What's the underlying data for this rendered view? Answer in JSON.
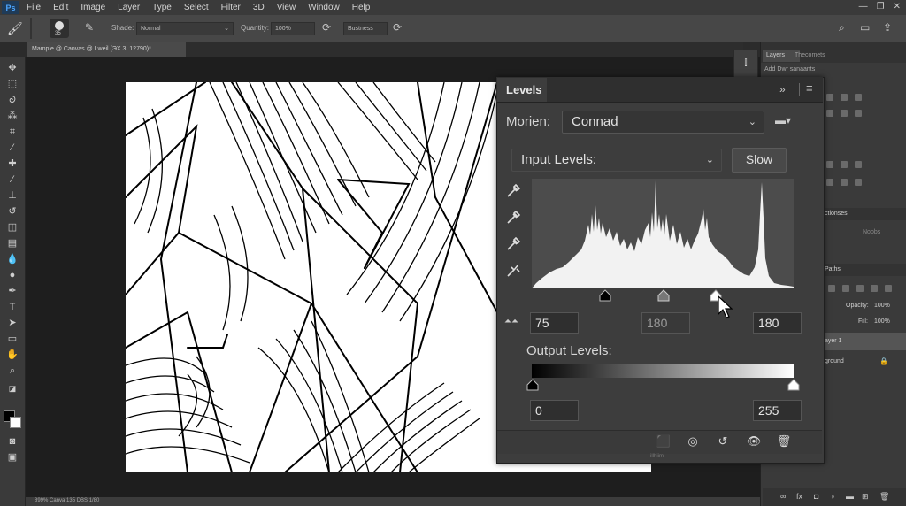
{
  "menubar": {
    "logo": "Ps",
    "items": [
      "File",
      "Edit",
      "Image",
      "Layer",
      "Type",
      "Select",
      "Filter",
      "3D",
      "View",
      "Window",
      "Help"
    ]
  },
  "options": {
    "brush_size": "35",
    "mode_label": "Shade:",
    "mode_value": "Normal",
    "opacity_label": "Quantity:",
    "opacity_value": "100%",
    "extra_field": "Bustness"
  },
  "document": {
    "tab_title": "Mample @ Canvas @ Lweil (ЭX 3, 12790)*",
    "status": "899%    Canva 135 DBS 1/80"
  },
  "dock": {
    "tab_layers": "Layers",
    "tab_other": "Thecomets",
    "add_text": "Add Dwr sanaants",
    "adjust_label": "ctionses",
    "fill_row": "Noobs",
    "paths_label": "Paths",
    "opacity_label": "Opacity:",
    "opacity_value": "100%",
    "fill_label": "Fill:",
    "fill_value": "100%",
    "layer1": "ayer 1",
    "layer2": "ground"
  },
  "levels": {
    "title": "Levels",
    "preset_label": "Morien:",
    "preset_value": "Connad",
    "input_label": "Input Levels:",
    "auto_button": "Slow",
    "input_black": "75",
    "input_gamma": "180",
    "input_white": "180",
    "output_label": "Output Levels:",
    "output_black": "0",
    "output_white": "255",
    "footer_hint": "illhiim"
  },
  "icons": {
    "eyedropper": "eyedropper-icon",
    "eye": "eye-icon",
    "trash": "trash-icon"
  },
  "colors": {
    "panel_bg": "#3d3d3d",
    "accent": "#4da6ff"
  }
}
